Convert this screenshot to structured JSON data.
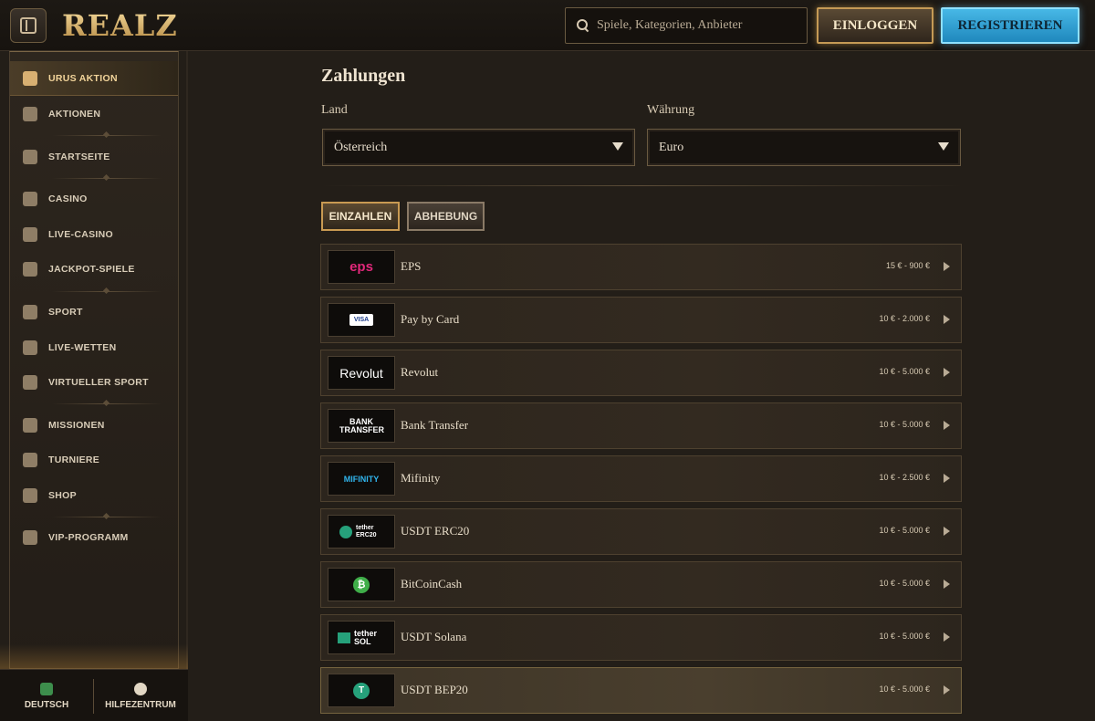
{
  "header": {
    "logo": "REALZ",
    "search_placeholder": "Spiele, Kategorien, Anbieter",
    "login_label": "EINLOGGEN",
    "register_label": "REGISTRIEREN"
  },
  "sidebar": {
    "items": [
      {
        "label": "URUS AKTION",
        "icon": "bull-icon"
      },
      {
        "label": "AKTIONEN",
        "icon": "gift-icon"
      },
      {
        "label": "STARTSEITE",
        "icon": "pyramid-icon"
      },
      {
        "label": "CASINO",
        "icon": "slot-machine-icon"
      },
      {
        "label": "LIVE-CASINO",
        "icon": "card-icon"
      },
      {
        "label": "JACKPOT-SPIELE",
        "icon": "clover-icon"
      },
      {
        "label": "SPORT",
        "icon": "basketball-icon"
      },
      {
        "label": "LIVE-WETTEN",
        "icon": "live-icon"
      },
      {
        "label": "VIRTUELLER SPORT",
        "icon": "virtual-sport-icon"
      },
      {
        "label": "MISSIONEN",
        "icon": "medal-icon"
      },
      {
        "label": "TURNIERE",
        "icon": "podium-icon"
      },
      {
        "label": "SHOP",
        "icon": "shopping-bag-icon"
      },
      {
        "label": "VIP-PROGRAMM",
        "icon": "diamond-icon"
      }
    ],
    "footer": {
      "language_label": "DEUTSCH",
      "help_label": "HILFEZENTRUM"
    }
  },
  "main": {
    "title": "Zahlungen",
    "country_label": "Land",
    "country_value": "Österreich",
    "currency_label": "Währung",
    "currency_value": "Euro",
    "tabs": [
      {
        "label": "EINZAHLEN",
        "active": true
      },
      {
        "label": "ABHEBUNG",
        "active": false
      }
    ],
    "methods": [
      {
        "name": "EPS",
        "range": "15 € - 900 €",
        "logo_text": "eps"
      },
      {
        "name": "Pay by Card",
        "range": "10 € - 2.000 €",
        "logo_text": "VISA"
      },
      {
        "name": "Revolut",
        "range": "10 € - 5.000 €",
        "logo_text": "Revolut"
      },
      {
        "name": "Bank Transfer",
        "range": "10 € - 5.000 €",
        "logo_text": "BANK TRANSFER"
      },
      {
        "name": "Mifinity",
        "range": "10 € - 2.500 €",
        "logo_text": "MIFINITY"
      },
      {
        "name": "USDT ERC20",
        "range": "10 € - 5.000 €",
        "logo_text": "tether ERC20"
      },
      {
        "name": "BitCoinCash",
        "range": "10 € - 5.000 €",
        "logo_text": "₿"
      },
      {
        "name": "USDT Solana",
        "range": "10 € - 5.000 €",
        "logo_text": "tether SOL"
      },
      {
        "name": "USDT BEP20",
        "range": "10 € - 5.000 €",
        "logo_text": "T"
      }
    ]
  },
  "colors": {
    "accent_gold": "#c99a52",
    "register_blue": "#2a9ad0",
    "background": "#231e18"
  }
}
